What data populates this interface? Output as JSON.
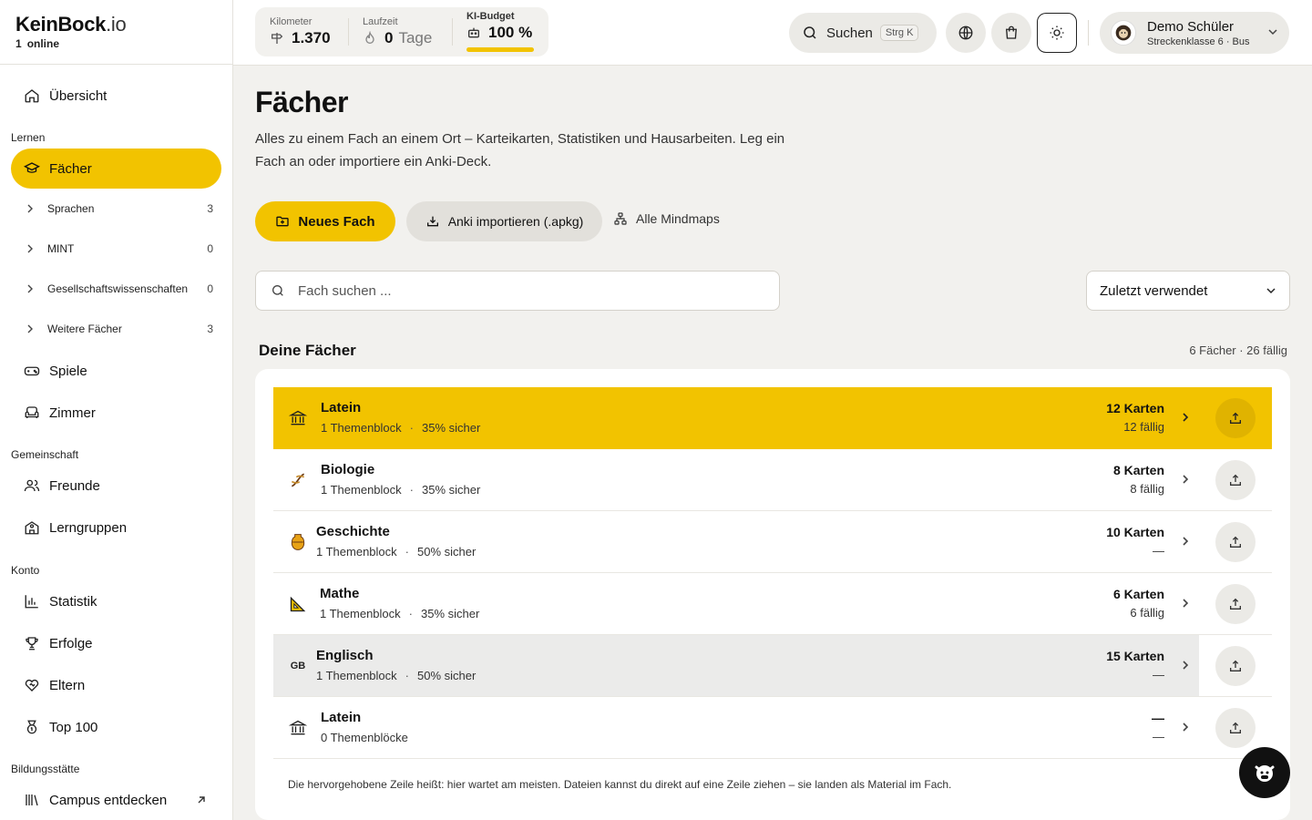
{
  "brand": {
    "name": "KeinBock",
    "tld": ".io",
    "online_count": "1",
    "online_label": "online"
  },
  "sidebar": {
    "overview": "Übersicht",
    "section_learn": "Lernen",
    "subjects": "Fächer",
    "categories": [
      {
        "label": "Sprachen",
        "count": "3"
      },
      {
        "label": "MINT",
        "count": "0"
      },
      {
        "label": "Gesellschaftswissenschaften",
        "count": "0"
      },
      {
        "label": "Weitere Fächer",
        "count": "3"
      }
    ],
    "games": "Spiele",
    "room": "Zimmer",
    "section_community": "Gemeinschaft",
    "friends": "Freunde",
    "groups": "Lerngruppen",
    "section_account": "Konto",
    "stats": "Statistik",
    "achievements": "Erfolge",
    "parents": "Eltern",
    "top100": "Top 100",
    "section_school": "Bildungsstätte",
    "campus": "Campus entdecken"
  },
  "topbar": {
    "km_label": "Kilometer",
    "km_value": "1.370",
    "runtime_label": "Laufzeit",
    "runtime_value": "0",
    "runtime_unit": "Tage",
    "ki_label": "KI-Budget",
    "ki_value": "100 %",
    "ki_level": 1.0,
    "search_label": "Suchen",
    "search_shortcut": "Strg K",
    "user_name": "Demo Schüler",
    "user_sub": "Streckenklasse 6 · Bus"
  },
  "main": {
    "title": "Fächer",
    "lead": "Alles zu einem Fach an einem Ort – Karteikarten, Statistiken und Hausarbeiten. Leg ein Fach an oder importiere ein Anki-Deck.",
    "btn_new": "Neues Fach",
    "btn_import": "Anki importieren (.apkg)",
    "btn_mindmaps": "Alle Mindmaps",
    "search_placeholder": "Fach suchen ...",
    "sort_value": "Zuletzt verwendet",
    "section_title": "Deine Fächer",
    "section_meta": "6 Fächer · 26 fällig",
    "dot": "·",
    "subjects": [
      {
        "name": "Latein",
        "blocks": "1 Themenblock",
        "secure": "35% sicher",
        "cards": "12 Karten",
        "due": "12 fällig",
        "icon": "temple-icon"
      },
      {
        "name": "Biologie",
        "blocks": "1 Themenblock",
        "secure": "35% sicher",
        "cards": "8 Karten",
        "due": "8 fällig",
        "icon": "dna-icon"
      },
      {
        "name": "Geschichte",
        "blocks": "1 Themenblock",
        "secure": "50% sicher",
        "cards": "10 Karten",
        "due": "—",
        "icon": "amphora-icon"
      },
      {
        "name": "Mathe",
        "blocks": "1 Themenblock",
        "secure": "35% sicher",
        "cards": "6 Karten",
        "due": "6 fällig",
        "icon": "triangle-ruler-icon"
      },
      {
        "name": "Englisch",
        "blocks": "1 Themenblock",
        "secure": "50% sicher",
        "cards": "15 Karten",
        "due": "—",
        "icon": "gb-flag-icon",
        "icon_text": "GB"
      },
      {
        "name": "Latein",
        "blocks": "0 Themenblöcke",
        "secure": "",
        "cards": "—",
        "due": "—",
        "icon": "temple-icon"
      }
    ],
    "footnote": "Die hervorgehobene Zeile heißt: hier wartet am meisten. Dateien kannst du direkt auf eine Zeile ziehen – sie landen als Material im Fach."
  },
  "colors": {
    "accent": "#f2c300",
    "background": "#f2f1ee"
  }
}
